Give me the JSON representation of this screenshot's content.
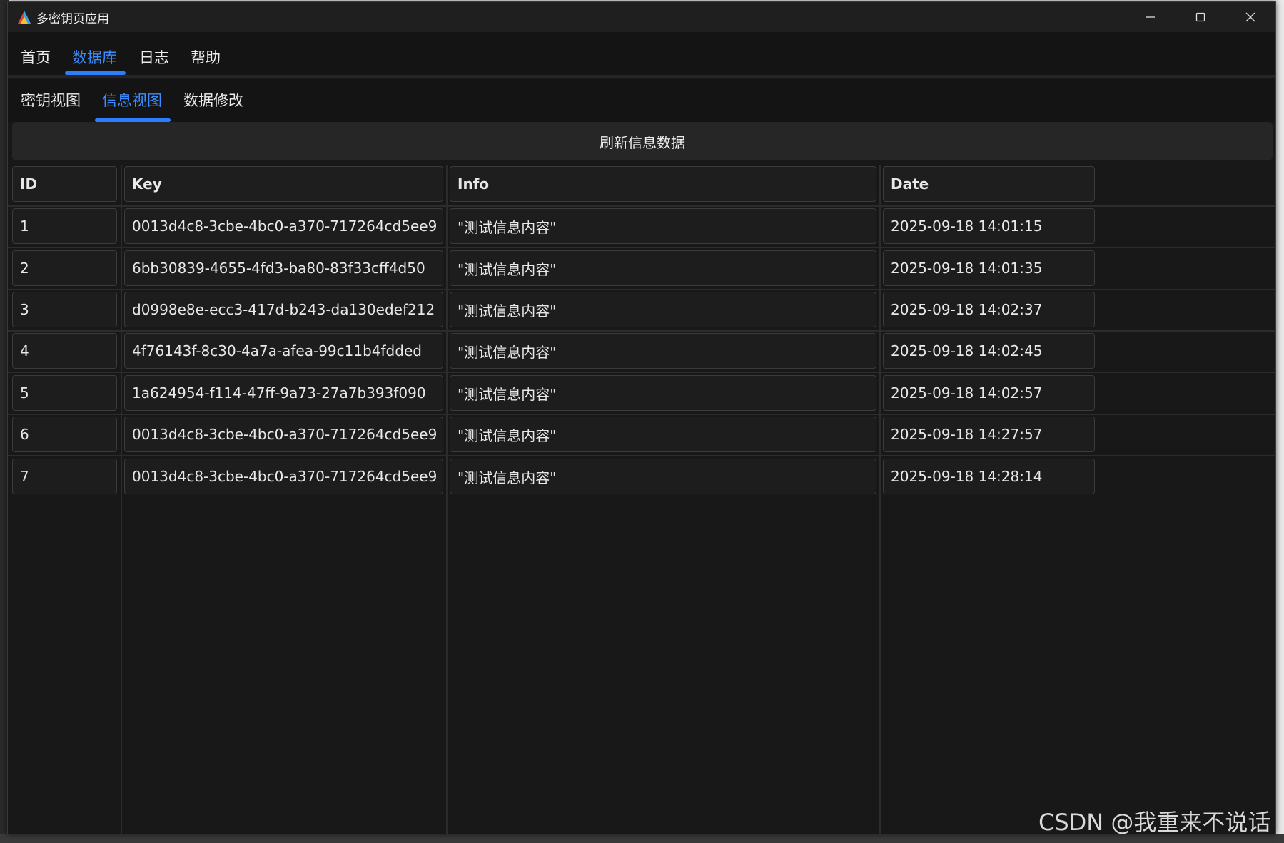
{
  "window": {
    "title": "多密钥页应用"
  },
  "menu": {
    "items": [
      "首页",
      "数据库",
      "日志",
      "帮助"
    ],
    "active": 1
  },
  "subtabs": {
    "items": [
      "密钥视图",
      "信息视图",
      "数据修改"
    ],
    "active": 1
  },
  "toolbar": {
    "refresh_label": "刷新信息数据"
  },
  "table": {
    "columns": [
      "ID",
      "Key",
      "Info",
      "Date"
    ],
    "rows": [
      [
        "1",
        "0013d4c8-3cbe-4bc0-a370-717264cd5ee9",
        "\"测试信息内容\"",
        "2025-09-18 14:01:15"
      ],
      [
        "2",
        "6bb30839-4655-4fd3-ba80-83f33cff4d50",
        "\"测试信息内容\"",
        "2025-09-18 14:01:35"
      ],
      [
        "3",
        "d0998e8e-ecc3-417d-b243-da130edef212",
        "\"测试信息内容\"",
        "2025-09-18 14:02:37"
      ],
      [
        "4",
        "4f76143f-8c30-4a7a-afea-99c11b4fdded",
        "\"测试信息内容\"",
        "2025-09-18 14:02:45"
      ],
      [
        "5",
        "1a624954-f114-47ff-9a73-27a7b393f090",
        "\"测试信息内容\"",
        "2025-09-18 14:02:57"
      ],
      [
        "6",
        "0013d4c8-3cbe-4bc0-a370-717264cd5ee9",
        "\"测试信息内容\"",
        "2025-09-18 14:27:57"
      ],
      [
        "7",
        "0013d4c8-3cbe-4bc0-a370-717264cd5ee9",
        "\"测试信息内容\"",
        "2025-09-18 14:28:14"
      ]
    ]
  },
  "watermark": "CSDN @我重来不说话",
  "colors": {
    "accent": "#2f7dff",
    "background": "#181818"
  }
}
